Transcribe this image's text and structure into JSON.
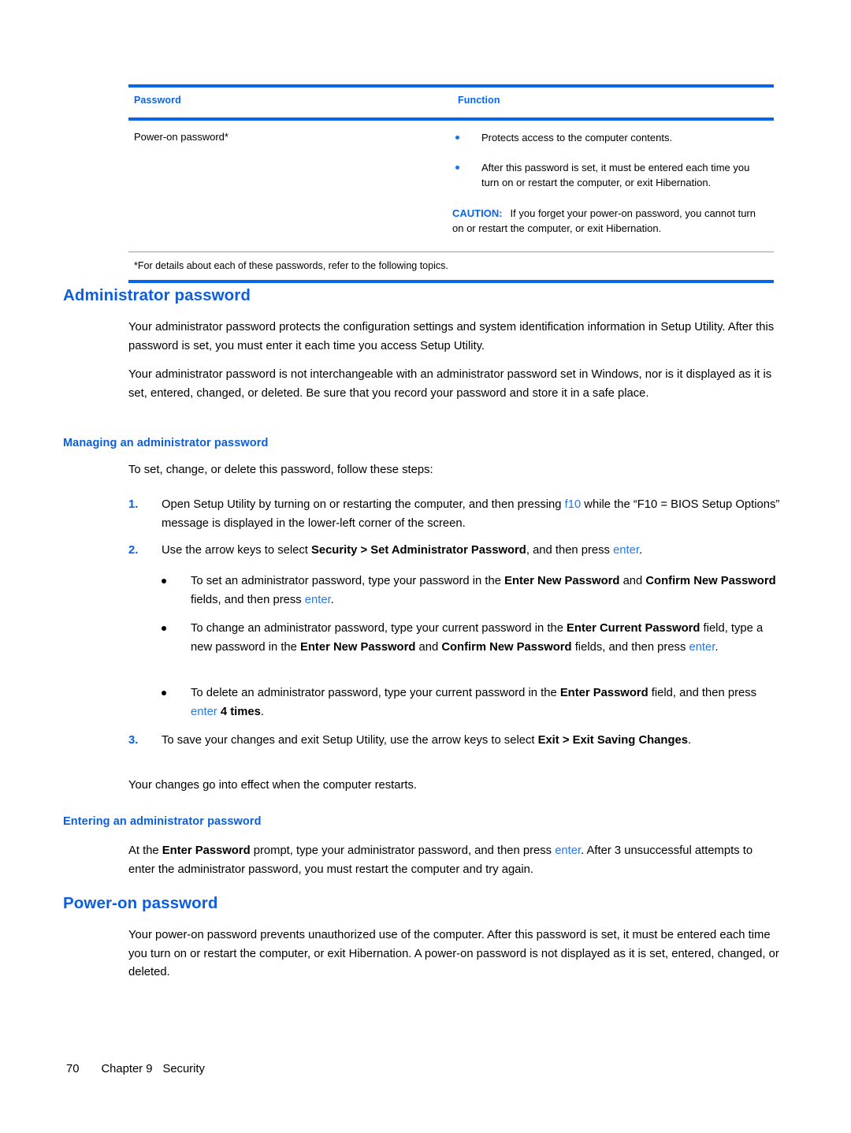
{
  "colors": {
    "accent_blue": "#0a66e8",
    "heading_blue": "#0a5fe0",
    "key_blue": "#2a78e8",
    "rule_thin": "#6aa5f0"
  },
  "table": {
    "headers": {
      "col1": "Password",
      "col2": "Function"
    },
    "row": {
      "password": "Power-on password*",
      "bullets": [
        "Protects access to the computer contents.",
        "After this password is set, it must be entered each time you turn on or restart the computer, or exit Hibernation."
      ],
      "caution": {
        "label": "CAUTION:",
        "text": "If you forget your power-on password, you cannot turn on or restart the computer, or exit Hibernation."
      }
    },
    "footnote": "*For details about each of these passwords, refer to the following topics."
  },
  "sections": {
    "admin": {
      "heading": "Administrator password",
      "para1": "Your administrator password protects the configuration settings and system identification information in Setup Utility. After this password is set, you must enter it each time you access Setup Utility.",
      "para2": "Your administrator password is not interchangeable with an administrator password set in Windows, nor is it displayed as it is set, entered, changed, or deleted. Be sure that you record your password and store it in a safe place."
    },
    "managing": {
      "heading": "Managing an administrator password",
      "intro": "To set, change, or delete this password, follow these steps:",
      "steps": [
        {
          "num": "1.",
          "part1": "Open Setup Utility by turning on or restarting the computer, and then pressing ",
          "key1": "f10",
          "part2": " while the “F10 = BIOS Setup Options” message is displayed in the lower-left corner of the screen."
        },
        {
          "num": "2.",
          "part1": "Use the arrow keys to select ",
          "bold1": "Security > Set Administrator Password",
          "part2": ", and then press ",
          "key1": "enter",
          "part3": "."
        },
        {
          "num": "3.",
          "part1": "To save your changes and exit Setup Utility, use the arrow keys to select ",
          "bold1": "Exit > Exit Saving Changes",
          "part2": "."
        }
      ],
      "bullets": [
        {
          "p1": "To set an administrator password, type your password in the ",
          "b1": "Enter New Password",
          "p2": " and ",
          "b2": "Confirm New Password",
          "p3": " fields, and then press ",
          "k1": "enter",
          "p4": "."
        },
        {
          "p1": "To change an administrator password, type your current password in the ",
          "b1": "Enter Current Password",
          "p2": " field, type a new password in the ",
          "b2": "Enter New Password",
          "p3": " and ",
          "b3": "Confirm New Password",
          "p4": " fields, and then press ",
          "k1": "enter",
          "p5": "."
        },
        {
          "p1": "To delete an administrator password, type your current password in the ",
          "b1": "Enter Password",
          "p2": " field, and then press ",
          "k1": "enter",
          "p3": " ",
          "b2": "4 times",
          "p4": "."
        }
      ],
      "closing": "Your changes go into effect when the computer restarts."
    },
    "entering": {
      "heading": "Entering an administrator password",
      "p1": "At the ",
      "b1": "Enter Password",
      "p2": " prompt, type your administrator password, and then press ",
      "k1": "enter",
      "p3": ". After 3 unsuccessful attempts to enter the administrator password, you must restart the computer and try again."
    },
    "poweron": {
      "heading": "Power-on password",
      "para1": "Your power-on password prevents unauthorized use of the computer. After this password is set, it must be entered each time you turn on or restart the computer, or exit Hibernation. A power-on password is not displayed as it is set, entered, changed, or deleted."
    }
  },
  "footer": {
    "page_number": "70",
    "chapter": "Chapter 9",
    "chapter_title": "Security"
  }
}
